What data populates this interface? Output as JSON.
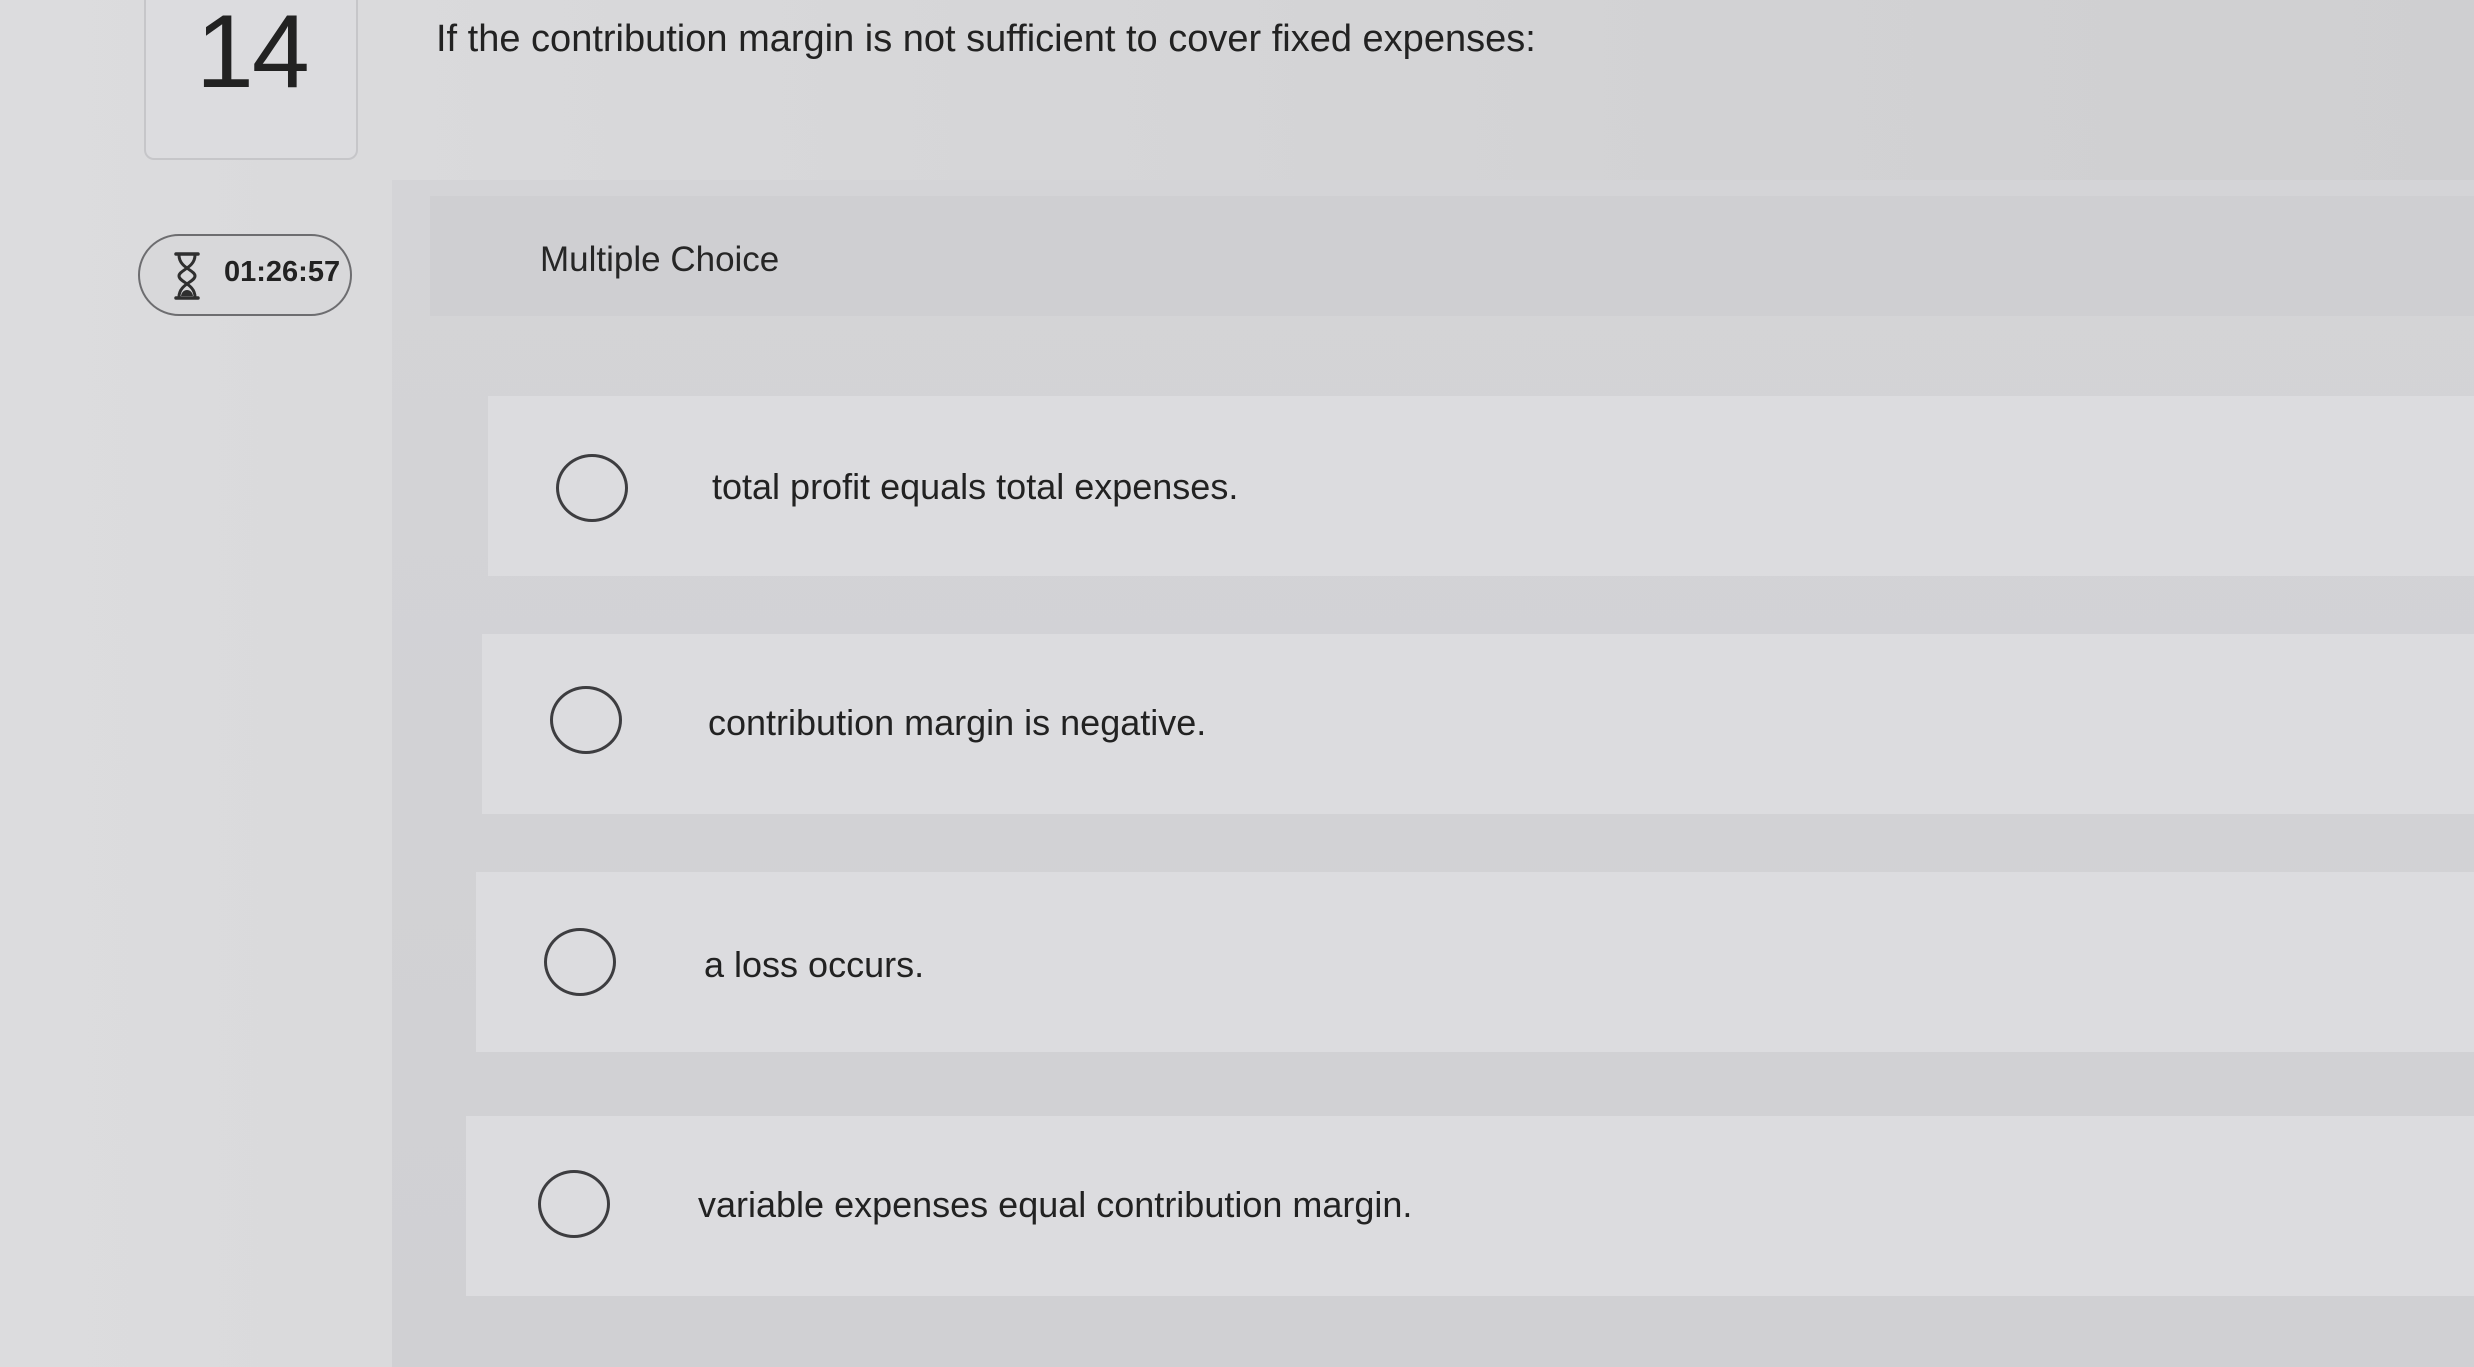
{
  "question": {
    "number": "14",
    "text": "If the contribution margin is not sufficient to cover fixed expenses:"
  },
  "timer": {
    "icon": "hourglass-icon",
    "value": "01:26:57"
  },
  "panel": {
    "type_label": "Multiple Choice",
    "choices": [
      {
        "label": "total profit equals total expenses."
      },
      {
        "label": "contribution margin is negative."
      },
      {
        "label": "a loss occurs."
      },
      {
        "label": "variable expenses equal contribution margin."
      }
    ]
  }
}
